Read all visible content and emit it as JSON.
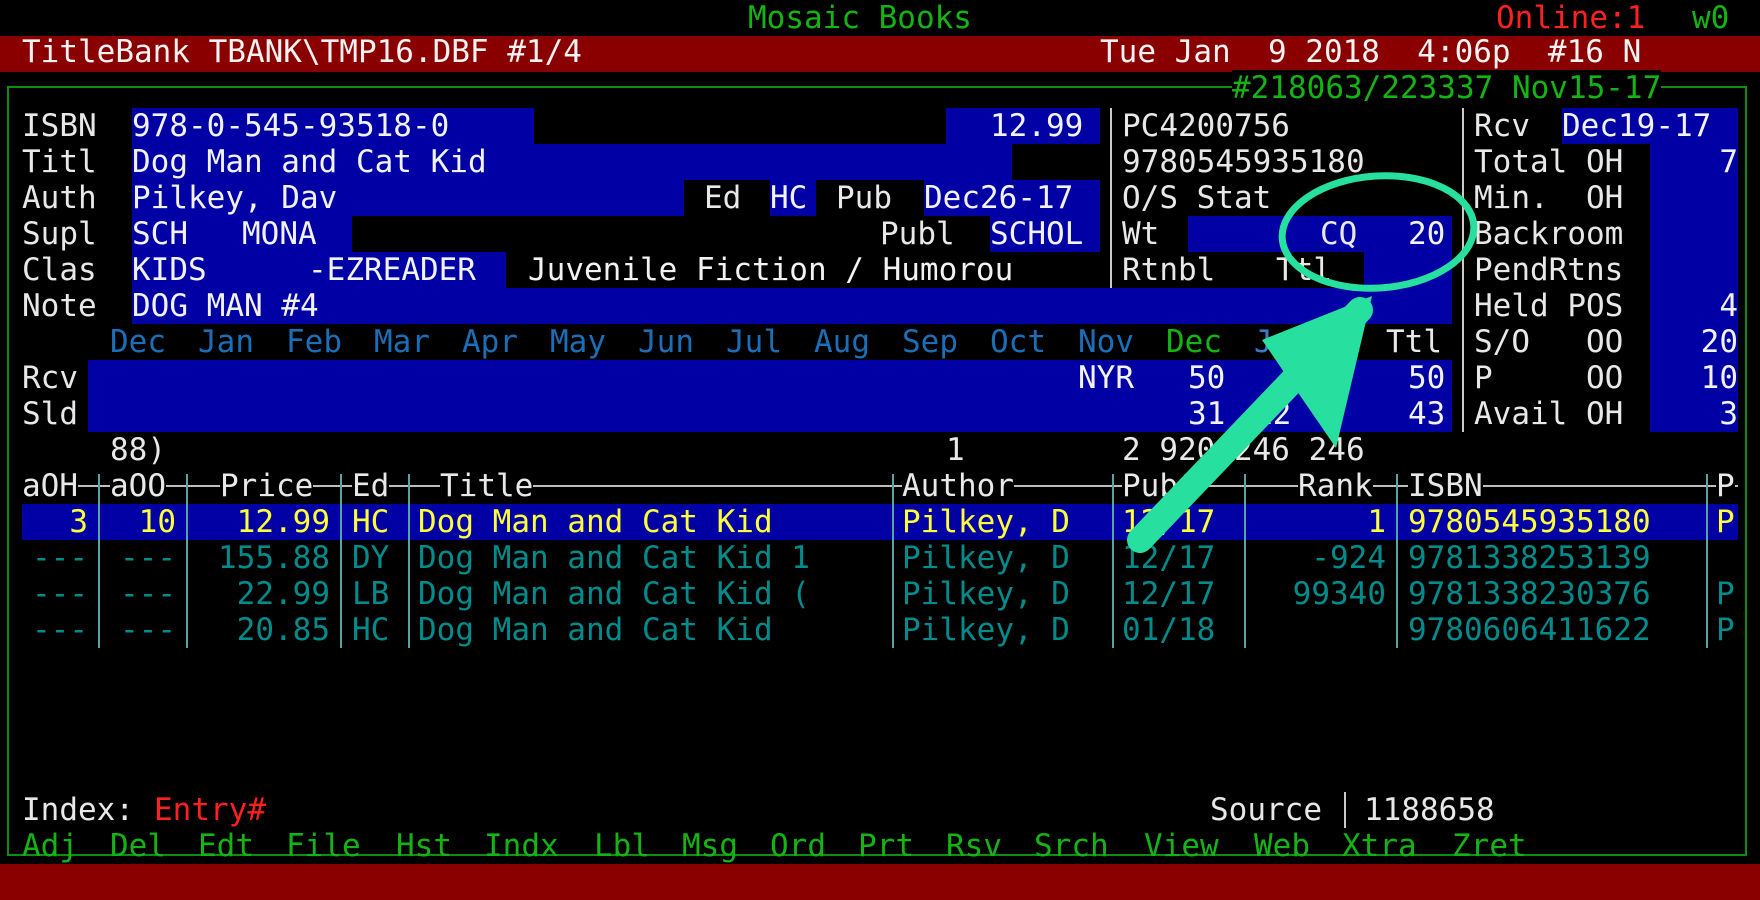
{
  "app": {
    "store_name": "Mosaic Books",
    "online_status": "Online:1",
    "online_w": "w0",
    "title_left": "TitleBank TBANK\\TMP16.DBF #1/4",
    "datetime": "Tue Jan  9 2018  4:06p  #16 N",
    "record_ref": "#218063/223337 Nov15-17"
  },
  "record": {
    "labels": {
      "isbn": "ISBN",
      "titl": "Titl",
      "auth": "Auth",
      "supl": "Supl",
      "clas": "Clas",
      "note": "Note",
      "ed": "Ed",
      "pub": "Pub",
      "publ": "Publ"
    },
    "isbn": "978-0-545-93518-0",
    "price": "12.99",
    "title": "Dog Man and Cat Kid",
    "author": "Pilkey, Dav",
    "edition": "HC",
    "pub_date": "Dec26-17",
    "supplier_code": "SCH",
    "supplier_name": "MONA",
    "publisher": "SCHOL",
    "class_code": "KIDS",
    "class_sub": "-EZREADER",
    "class_desc": "Juvenile Fiction / Humorou",
    "note": "DOG MAN #4"
  },
  "middle": {
    "pc_code": "PC4200756",
    "ean": "9780545935180",
    "os_stat": "O/S Stat",
    "wt": "Wt",
    "cq_label": "CQ",
    "cq_value": "20",
    "rtnbl": "Rtnbl",
    "ttl": "Ttl"
  },
  "right": {
    "rcv_label": "Rcv",
    "rcv_date": "Dec19-17",
    "rows": [
      {
        "label": "Total OH",
        "value": "7"
      },
      {
        "label": "Min.  OH",
        "value": ""
      },
      {
        "label": "Backroom",
        "value": ""
      },
      {
        "label": "PendRtns",
        "value": ""
      },
      {
        "label": "Held POS",
        "value": "4"
      },
      {
        "label": "S/O   OO",
        "value": "20"
      },
      {
        "label": "P     OO",
        "value": "10"
      },
      {
        "label": "Avail OH",
        "value": "3"
      }
    ]
  },
  "months": {
    "list": [
      "Dec",
      "Jan",
      "Feb",
      "Mar",
      "Apr",
      "May",
      "Jun",
      "Jul",
      "Aug",
      "Sep",
      "Oct",
      "Nov"
    ],
    "current": "Dec",
    "next_partial": "Ja",
    "ttl_label": "Ttl",
    "rcv_label": "Rcv",
    "sld_label": "Sld",
    "nyr": "NYR",
    "rcv_current": "50",
    "rcv_ttl": "50",
    "sld_current": "31",
    "sld_next": "12",
    "sld_ttl": "43"
  },
  "summary": {
    "left": "88)",
    "mid": "1",
    "right": "2 920 246 246"
  },
  "table": {
    "headers": {
      "aoh": "aOH",
      "aoo": "aOO",
      "price": "Price",
      "ed": "Ed",
      "title": "Title",
      "author": "Author",
      "pub": "Pubt",
      "rank": "Rank",
      "isbn": "ISBN",
      "p": "P"
    },
    "rows": [
      {
        "aoh": "3",
        "aoo": "10",
        "price": "12.99",
        "ed": "HC",
        "title": "Dog Man and Cat Kid",
        "author": "Pilkey, D",
        "pub": "12/17",
        "rank": "1",
        "isbn": "9780545935180",
        "p": "P"
      },
      {
        "aoh": "---",
        "aoo": "---",
        "price": "155.88",
        "ed": "DY",
        "title": "Dog Man and Cat Kid 1",
        "author": "Pilkey, D",
        "pub": "12/17",
        "rank": "-924",
        "isbn": "9781338253139",
        "p": ""
      },
      {
        "aoh": "---",
        "aoo": "---",
        "price": "22.99",
        "ed": "LB",
        "title": "Dog Man and Cat Kid (",
        "author": "Pilkey, D",
        "pub": "12/17",
        "rank": "99340",
        "isbn": "9781338230376",
        "p": "P"
      },
      {
        "aoh": "---",
        "aoo": "---",
        "price": "20.85",
        "ed": "HC",
        "title": "Dog Man and Cat Kid",
        "author": "Pilkey, D",
        "pub": "01/18",
        "rank": "",
        "isbn": "9780606411622",
        "p": "P"
      }
    ]
  },
  "footer": {
    "index_label": "Index:",
    "index_value": "Entry#",
    "source_label": "Source",
    "source_value": "1188658",
    "menu": [
      "Adj",
      "Del",
      "Edt",
      "File",
      "Hst",
      "Indx",
      "Lbl",
      "Msg",
      "Ord",
      "Prt",
      "Rsv",
      "Srch",
      "View",
      "Web",
      "Xtra",
      "Zret"
    ]
  },
  "annotation": {
    "color": "#27e0a0"
  }
}
